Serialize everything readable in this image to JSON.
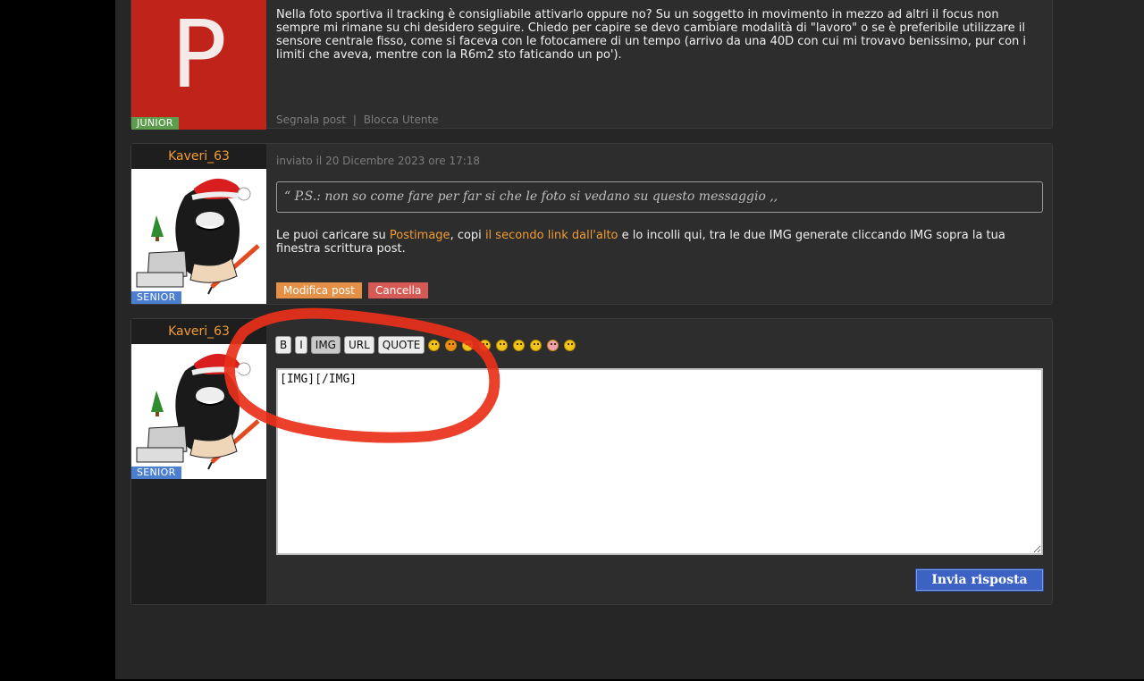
{
  "post1": {
    "avatar_letter": "P",
    "avatar_bg": "#c0231a",
    "rank": "JUNIOR",
    "text": "Nella foto sportiva il tracking è consigliabile attivarlo oppure no? Su un soggetto in movimento in mezzo ad altri il focus non sempre mi rimane su chi desidero seguire. Chiedo per capire se devo cambiare modalità di \"lavoro\" o se è preferibile utilizzare il sensore centrale fisso, come si faceva con le fotocamere di un tempo (arrivo da una 40D con cui mi trovavo benissimo, pur con i limiti che aveva, mentre con la R6m2 sto faticando un po').",
    "report_link": "Segnala post",
    "separator": "|",
    "block_link": "Blocca Utente"
  },
  "post2": {
    "username": "Kaveri_63",
    "rank": "SENIOR",
    "timestamp": "inviato il 20 Dicembre 2023 ore 17:18",
    "quote_open": "“",
    "quote_text": "P.S.: non so come fare per far si che le foto si vedano su questo messaggio",
    "quote_close": ",,",
    "text_1": "Le puoi caricare su ",
    "link_1": "Postimage",
    "text_2": ", copi ",
    "link_2": "il secondo link dall'alto",
    "text_3": " e lo incolli qui, tra le due IMG generate cliccando IMG sopra la tua finestra scrittura post.",
    "edit_label": "Modifica post",
    "delete_label": "Cancella"
  },
  "reply": {
    "username": "Kaveri_63",
    "rank": "SENIOR",
    "toolbar": [
      "B",
      "I",
      "IMG",
      "URL",
      "QUOTE"
    ],
    "emoticons": [
      "grin-icon",
      "angry-icon",
      "cool-icon",
      "wink-icon",
      "happy-icon",
      "surprised-icon",
      "confused-icon",
      "blush-icon",
      "sad-icon"
    ],
    "textarea_value": "[IMG][/IMG]",
    "submit_label": "Invia risposta"
  },
  "annotation": {
    "color": "#e8301a"
  }
}
